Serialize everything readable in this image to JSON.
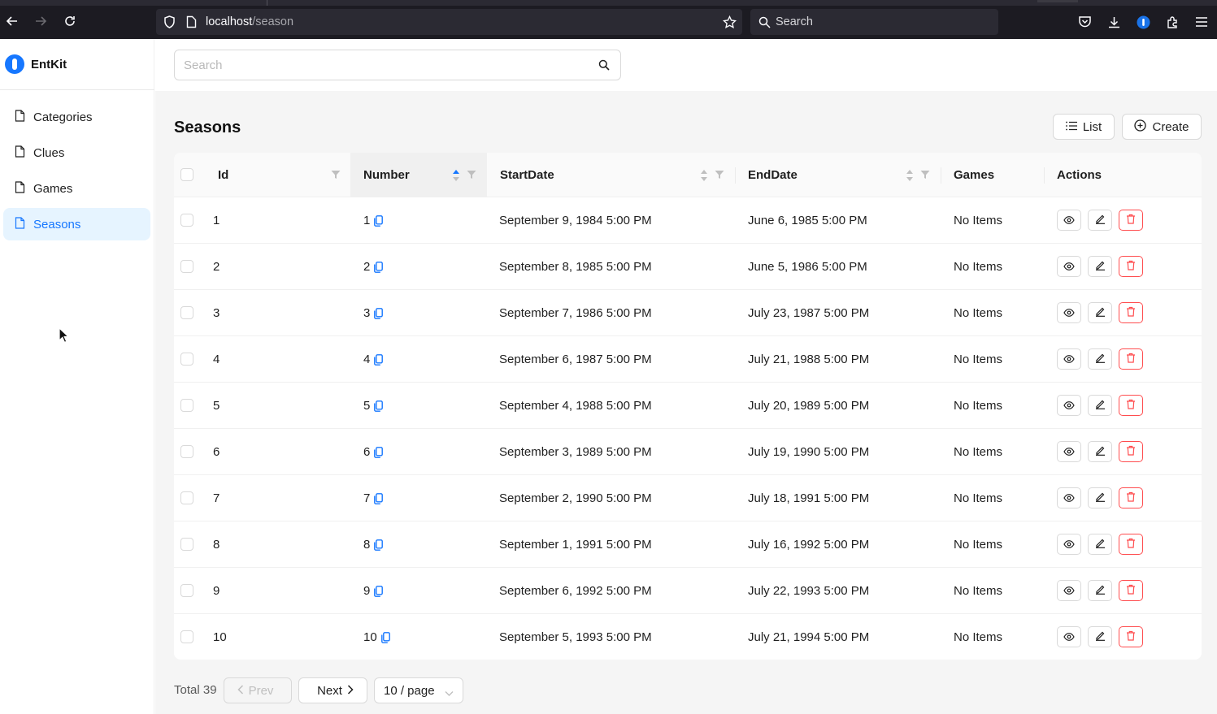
{
  "browser": {
    "url_host": "localhost",
    "url_path": "/season",
    "search_placeholder": "Search"
  },
  "app": {
    "name": "EntKit"
  },
  "sidebar": {
    "items": [
      {
        "label": "Categories",
        "active": false
      },
      {
        "label": "Clues",
        "active": false
      },
      {
        "label": "Games",
        "active": false
      },
      {
        "label": "Seasons",
        "active": true
      }
    ]
  },
  "topbar": {
    "search_placeholder": "Search"
  },
  "page": {
    "title": "Seasons",
    "list_label": "List",
    "create_label": "Create"
  },
  "table": {
    "columns": [
      "Id",
      "Number",
      "StartDate",
      "EndDate",
      "Games",
      "Actions"
    ],
    "rows": [
      {
        "id": "1",
        "number": "1",
        "start": "September 9, 1984 5:00 PM",
        "end": "June 6, 1985 5:00 PM",
        "games": "No Items"
      },
      {
        "id": "2",
        "number": "2",
        "start": "September 8, 1985 5:00 PM",
        "end": "June 5, 1986 5:00 PM",
        "games": "No Items"
      },
      {
        "id": "3",
        "number": "3",
        "start": "September 7, 1986 5:00 PM",
        "end": "July 23, 1987 5:00 PM",
        "games": "No Items"
      },
      {
        "id": "4",
        "number": "4",
        "start": "September 6, 1987 5:00 PM",
        "end": "July 21, 1988 5:00 PM",
        "games": "No Items"
      },
      {
        "id": "5",
        "number": "5",
        "start": "September 4, 1988 5:00 PM",
        "end": "July 20, 1989 5:00 PM",
        "games": "No Items"
      },
      {
        "id": "6",
        "number": "6",
        "start": "September 3, 1989 5:00 PM",
        "end": "July 19, 1990 5:00 PM",
        "games": "No Items"
      },
      {
        "id": "7",
        "number": "7",
        "start": "September 2, 1990 5:00 PM",
        "end": "July 18, 1991 5:00 PM",
        "games": "No Items"
      },
      {
        "id": "8",
        "number": "8",
        "start": "September 1, 1991 5:00 PM",
        "end": "July 16, 1992 5:00 PM",
        "games": "No Items"
      },
      {
        "id": "9",
        "number": "9",
        "start": "September 6, 1992 5:00 PM",
        "end": "July 22, 1993 5:00 PM",
        "games": "No Items"
      },
      {
        "id": "10",
        "number": "10",
        "start": "September 5, 1993 5:00 PM",
        "end": "July 21, 1994 5:00 PM",
        "games": "No Items"
      }
    ]
  },
  "pagination": {
    "total": "Total 39",
    "prev_label": "Prev",
    "next_label": "Next",
    "page_size": "10 / page"
  },
  "colors": {
    "accent": "#1677ff",
    "danger": "#ff4d4f"
  }
}
